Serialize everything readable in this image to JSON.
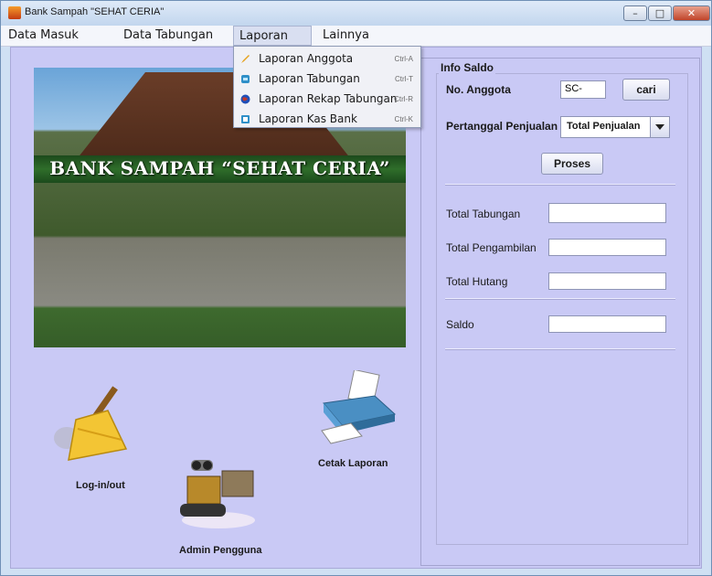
{
  "window": {
    "title": "Bank Sampah \"SEHAT CERIA\""
  },
  "menubar": [
    "Data Masuk",
    "Data Tabungan",
    "Laporan",
    "Lainnya"
  ],
  "laporan_menu": [
    {
      "label": "Laporan Anggota",
      "shortcut": "Ctrl-A",
      "icon": "pencil-icon"
    },
    {
      "label": "Laporan Tabungan",
      "shortcut": "Ctrl-T",
      "icon": "savings-icon"
    },
    {
      "label": "Laporan Rekap Tabungan",
      "shortcut": "Ctrl-R",
      "icon": "globe-icon"
    },
    {
      "label": "Laporan Kas Bank",
      "shortcut": "Ctrl-K",
      "icon": "bank-icon"
    }
  ],
  "photo": {
    "caption": "BANK SAMPAH “SEHAT CERIA”"
  },
  "shortcuts": {
    "logout": "Log-in/out",
    "admin": "Admin Pengguna",
    "print": "Cetak Laporan"
  },
  "info_saldo": {
    "title": "Info Saldo",
    "no_anggota_label": "No. Anggota",
    "no_anggota_value": "SC-",
    "cari_button": "cari",
    "pertanggal_label": "Pertanggal Penjualan",
    "combo_selected": "Total Penjualan",
    "proses_button": "Proses",
    "total_tabungan_label": "Total Tabungan",
    "total_pengambilan_label": "Total Pengambilan",
    "total_hutang_label": "Total Hutang",
    "saldo_label": "Saldo",
    "total_tabungan_value": "",
    "total_pengambilan_value": "",
    "total_hutang_value": "",
    "saldo_value": ""
  },
  "colors": {
    "background": "#c9c9f5",
    "menu_highlight": "#d9dff1"
  }
}
